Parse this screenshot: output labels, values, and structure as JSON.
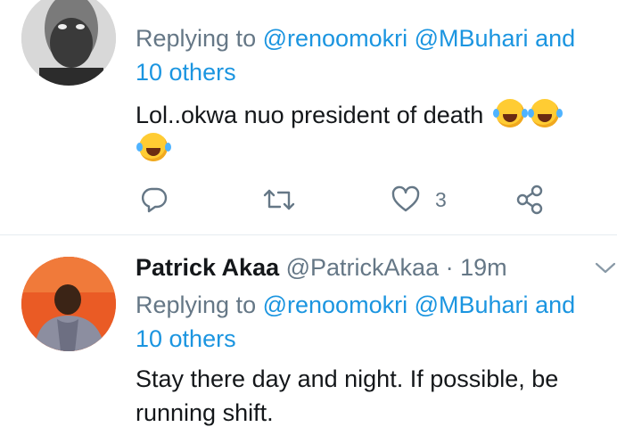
{
  "tweets": [
    {
      "replying_label": "Replying to",
      "mention_1": "@renoomokri",
      "mention_2": "@MBuhari",
      "mention_and": "and",
      "mention_others": "10 others",
      "text_line_1": "Lol..okwa nuo president of death",
      "emoji_name": "face-with-tears-of-joy-icon",
      "like_count": "3"
    },
    {
      "display_name": "Patrick Akaa",
      "handle": "@PatrickAkaa",
      "separator": "·",
      "time": "19m",
      "replying_label": "Replying to",
      "mention_1": "@renoomokri",
      "mention_2": "@MBuhari",
      "mention_and": "and",
      "mention_others": "10 others",
      "text_line_1": "Stay there day and night. If possible, be",
      "text_line_2": "running shift."
    }
  ],
  "colors": {
    "link": "#1b95e0",
    "secondary_text": "#657786",
    "primary_text": "#14171a",
    "divider": "#e6ecf0"
  }
}
